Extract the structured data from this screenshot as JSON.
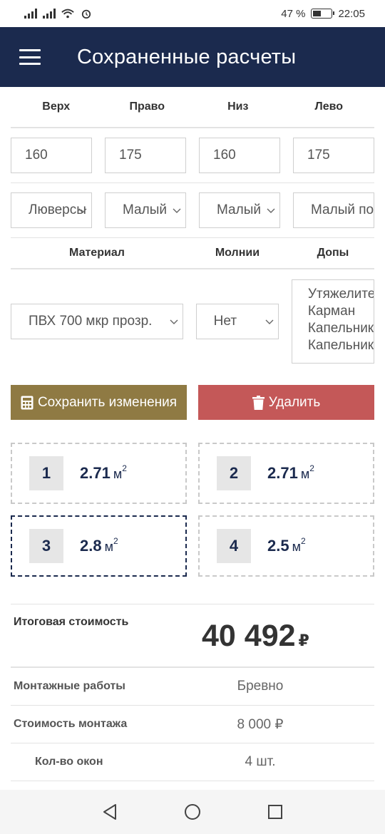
{
  "status": {
    "battery": "47 %",
    "battery_level": 0.47,
    "time": "22:05"
  },
  "header": {
    "title": "Сохраненные расчеты"
  },
  "sides": {
    "labels": [
      "Верх",
      "Право",
      "Низ",
      "Лево"
    ],
    "values": [
      "160",
      "175",
      "160",
      "175"
    ],
    "fasteners": [
      "Люверсы",
      "Малый",
      "Малый",
      "Малый по"
    ]
  },
  "materials": {
    "labels": {
      "material": "Материал",
      "zippers": "Молнии",
      "extras": "Допы"
    },
    "material_value": "ПВХ 700 мкр прозр.",
    "zippers_value": "Нет",
    "extras": [
      "Утяжелитель",
      "Карман",
      "Капельник",
      "Капельник"
    ]
  },
  "actions": {
    "save_label": "Сохранить изменения",
    "delete_label": "Удалить"
  },
  "windows": [
    {
      "num": "1",
      "area": "2.71",
      "unit": "м",
      "sup": "2"
    },
    {
      "num": "2",
      "area": "2.71",
      "unit": "м",
      "sup": "2"
    },
    {
      "num": "3",
      "area": "2.8",
      "unit": "м",
      "sup": "2"
    },
    {
      "num": "4",
      "area": "2.5",
      "unit": "м",
      "sup": "2"
    }
  ],
  "summary": {
    "total_label": "Итоговая стоимость",
    "total_value": "40 492",
    "currency": "₽",
    "rows": [
      {
        "label": "Монтажные работы",
        "value": "Бревно"
      },
      {
        "label": "Стоимость монтажа",
        "value": "8 000 ₽"
      },
      {
        "label": "Кол-во окон",
        "value": "4 шт."
      }
    ]
  },
  "colors": {
    "header": "#1b2a4e",
    "save": "#8f7a43",
    "delete": "#c45858"
  }
}
